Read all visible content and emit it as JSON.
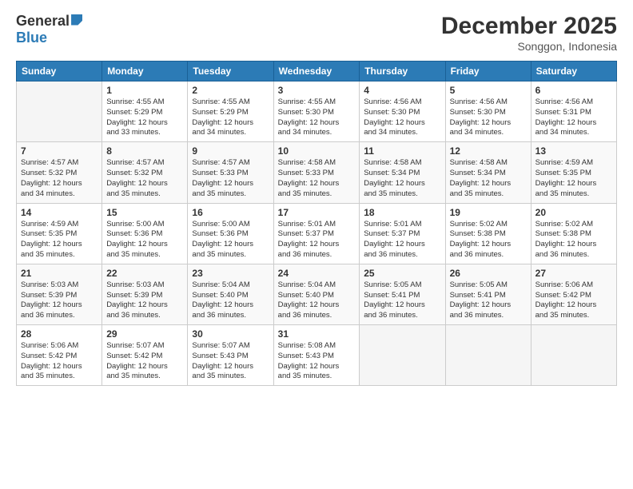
{
  "logo": {
    "general": "General",
    "blue": "Blue"
  },
  "title": "December 2025",
  "subtitle": "Songgon, Indonesia",
  "days_header": [
    "Sunday",
    "Monday",
    "Tuesday",
    "Wednesday",
    "Thursday",
    "Friday",
    "Saturday"
  ],
  "weeks": [
    [
      {
        "day": "",
        "info": ""
      },
      {
        "day": "1",
        "info": "Sunrise: 4:55 AM\nSunset: 5:29 PM\nDaylight: 12 hours\nand 33 minutes."
      },
      {
        "day": "2",
        "info": "Sunrise: 4:55 AM\nSunset: 5:29 PM\nDaylight: 12 hours\nand 34 minutes."
      },
      {
        "day": "3",
        "info": "Sunrise: 4:55 AM\nSunset: 5:30 PM\nDaylight: 12 hours\nand 34 minutes."
      },
      {
        "day": "4",
        "info": "Sunrise: 4:56 AM\nSunset: 5:30 PM\nDaylight: 12 hours\nand 34 minutes."
      },
      {
        "day": "5",
        "info": "Sunrise: 4:56 AM\nSunset: 5:30 PM\nDaylight: 12 hours\nand 34 minutes."
      },
      {
        "day": "6",
        "info": "Sunrise: 4:56 AM\nSunset: 5:31 PM\nDaylight: 12 hours\nand 34 minutes."
      }
    ],
    [
      {
        "day": "7",
        "info": "Sunrise: 4:57 AM\nSunset: 5:32 PM\nDaylight: 12 hours\nand 34 minutes."
      },
      {
        "day": "8",
        "info": "Sunrise: 4:57 AM\nSunset: 5:32 PM\nDaylight: 12 hours\nand 35 minutes."
      },
      {
        "day": "9",
        "info": "Sunrise: 4:57 AM\nSunset: 5:33 PM\nDaylight: 12 hours\nand 35 minutes."
      },
      {
        "day": "10",
        "info": "Sunrise: 4:58 AM\nSunset: 5:33 PM\nDaylight: 12 hours\nand 35 minutes."
      },
      {
        "day": "11",
        "info": "Sunrise: 4:58 AM\nSunset: 5:34 PM\nDaylight: 12 hours\nand 35 minutes."
      },
      {
        "day": "12",
        "info": "Sunrise: 4:58 AM\nSunset: 5:34 PM\nDaylight: 12 hours\nand 35 minutes."
      },
      {
        "day": "13",
        "info": "Sunrise: 4:59 AM\nSunset: 5:35 PM\nDaylight: 12 hours\nand 35 minutes."
      }
    ],
    [
      {
        "day": "14",
        "info": "Sunrise: 4:59 AM\nSunset: 5:35 PM\nDaylight: 12 hours\nand 35 minutes."
      },
      {
        "day": "15",
        "info": "Sunrise: 5:00 AM\nSunset: 5:36 PM\nDaylight: 12 hours\nand 35 minutes."
      },
      {
        "day": "16",
        "info": "Sunrise: 5:00 AM\nSunset: 5:36 PM\nDaylight: 12 hours\nand 35 minutes."
      },
      {
        "day": "17",
        "info": "Sunrise: 5:01 AM\nSunset: 5:37 PM\nDaylight: 12 hours\nand 36 minutes."
      },
      {
        "day": "18",
        "info": "Sunrise: 5:01 AM\nSunset: 5:37 PM\nDaylight: 12 hours\nand 36 minutes."
      },
      {
        "day": "19",
        "info": "Sunrise: 5:02 AM\nSunset: 5:38 PM\nDaylight: 12 hours\nand 36 minutes."
      },
      {
        "day": "20",
        "info": "Sunrise: 5:02 AM\nSunset: 5:38 PM\nDaylight: 12 hours\nand 36 minutes."
      }
    ],
    [
      {
        "day": "21",
        "info": "Sunrise: 5:03 AM\nSunset: 5:39 PM\nDaylight: 12 hours\nand 36 minutes."
      },
      {
        "day": "22",
        "info": "Sunrise: 5:03 AM\nSunset: 5:39 PM\nDaylight: 12 hours\nand 36 minutes."
      },
      {
        "day": "23",
        "info": "Sunrise: 5:04 AM\nSunset: 5:40 PM\nDaylight: 12 hours\nand 36 minutes."
      },
      {
        "day": "24",
        "info": "Sunrise: 5:04 AM\nSunset: 5:40 PM\nDaylight: 12 hours\nand 36 minutes."
      },
      {
        "day": "25",
        "info": "Sunrise: 5:05 AM\nSunset: 5:41 PM\nDaylight: 12 hours\nand 36 minutes."
      },
      {
        "day": "26",
        "info": "Sunrise: 5:05 AM\nSunset: 5:41 PM\nDaylight: 12 hours\nand 36 minutes."
      },
      {
        "day": "27",
        "info": "Sunrise: 5:06 AM\nSunset: 5:42 PM\nDaylight: 12 hours\nand 35 minutes."
      }
    ],
    [
      {
        "day": "28",
        "info": "Sunrise: 5:06 AM\nSunset: 5:42 PM\nDaylight: 12 hours\nand 35 minutes."
      },
      {
        "day": "29",
        "info": "Sunrise: 5:07 AM\nSunset: 5:42 PM\nDaylight: 12 hours\nand 35 minutes."
      },
      {
        "day": "30",
        "info": "Sunrise: 5:07 AM\nSunset: 5:43 PM\nDaylight: 12 hours\nand 35 minutes."
      },
      {
        "day": "31",
        "info": "Sunrise: 5:08 AM\nSunset: 5:43 PM\nDaylight: 12 hours\nand 35 minutes."
      },
      {
        "day": "",
        "info": ""
      },
      {
        "day": "",
        "info": ""
      },
      {
        "day": "",
        "info": ""
      }
    ]
  ]
}
